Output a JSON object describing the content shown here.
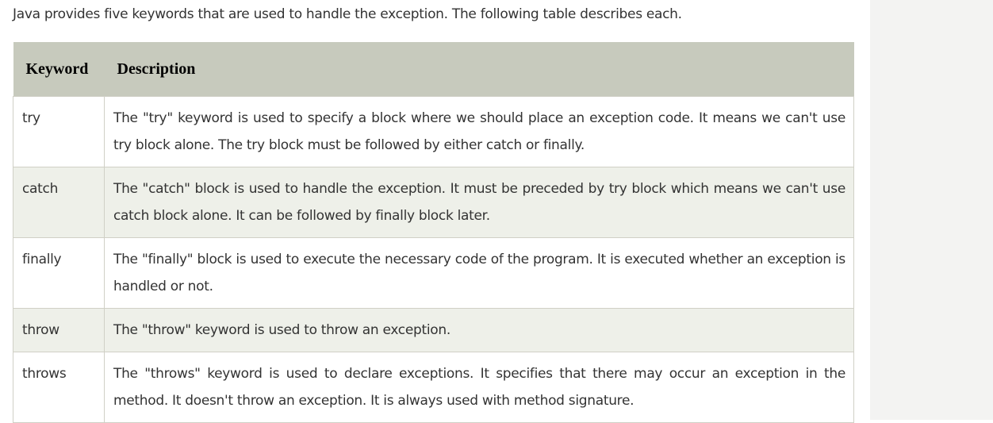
{
  "intro": "Java provides five keywords that are used to handle the exception. The following table describes each.",
  "table": {
    "headers": [
      "Keyword",
      "Description"
    ],
    "rows": [
      {
        "keyword": "try",
        "description": "The \"try\" keyword is used to specify a block where we should place an exception code. It means we can't use try block alone. The try block must be followed by either catch or finally."
      },
      {
        "keyword": "catch",
        "description": "The \"catch\" block is used to handle the exception. It must be preceded by try block which means we can't use catch block alone. It can be followed by finally block later."
      },
      {
        "keyword": "finally",
        "description": "The \"finally\" block is used to execute the necessary code of the program. It is executed whether an exception is handled or not."
      },
      {
        "keyword": "throw",
        "description": "The \"throw\" keyword is used to throw an exception."
      },
      {
        "keyword": "throws",
        "description": "The \"throws\" keyword is used to declare exceptions. It specifies that there may occur an exception in the method. It doesn't throw an exception. It is always used with method signature."
      }
    ]
  }
}
